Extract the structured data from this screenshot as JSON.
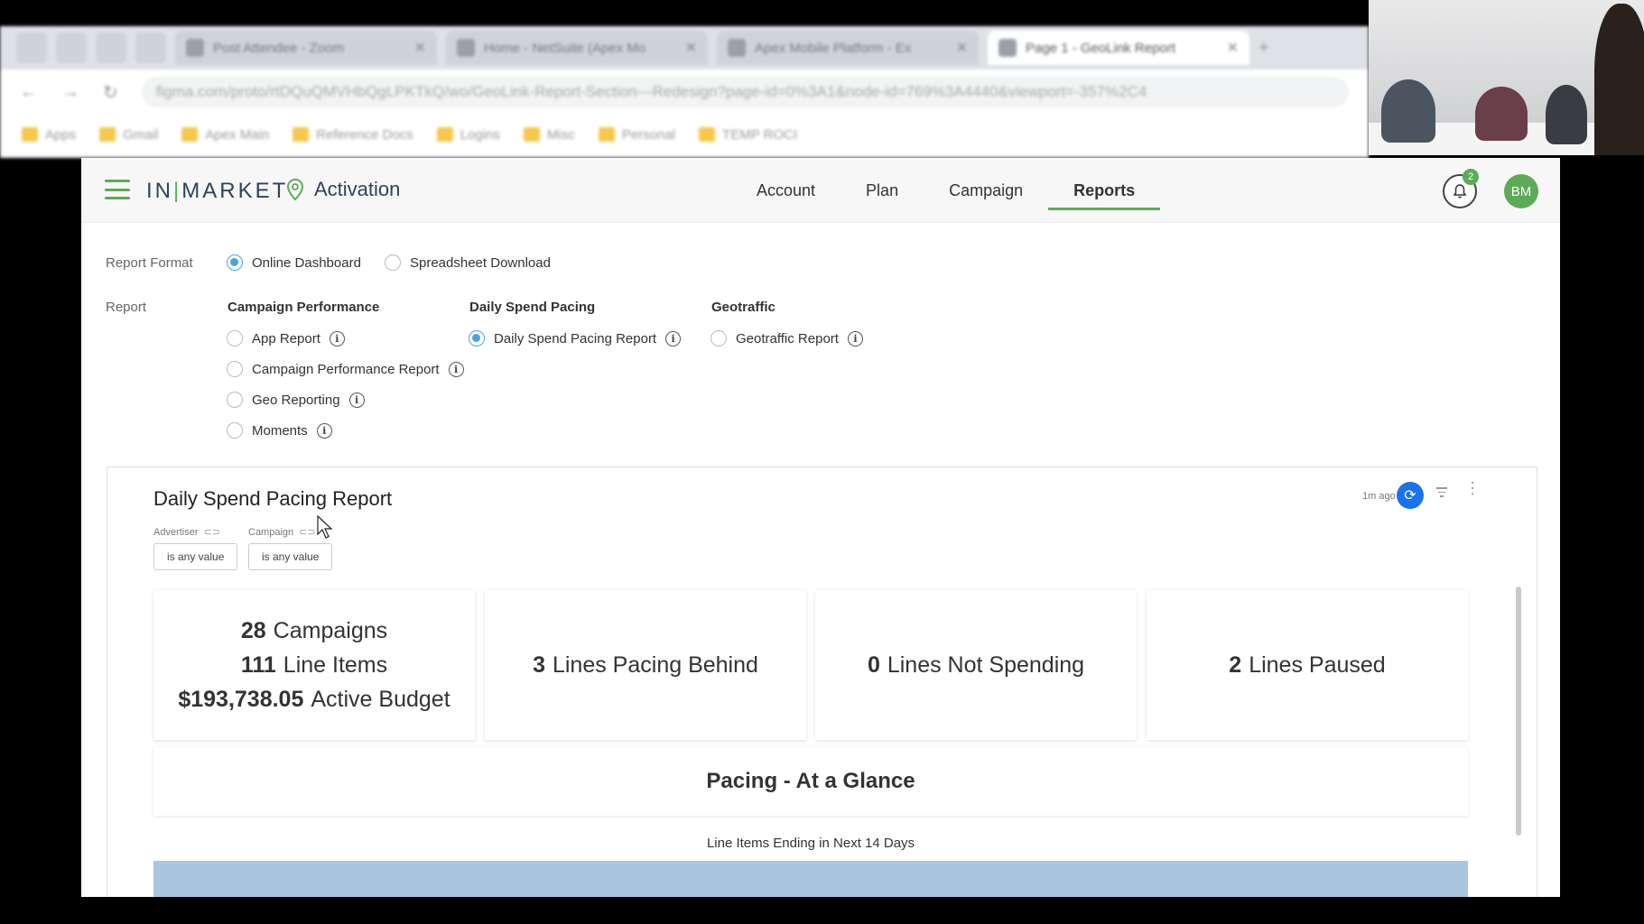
{
  "browser": {
    "tabs": [
      {
        "title": "Post Attendee - Zoom"
      },
      {
        "title": "Home - NetSuite (Apex Mo"
      },
      {
        "title": "Apex Mobile Platform - Ex"
      },
      {
        "title": "Page 1 - GeoLink Report"
      }
    ],
    "url": "figma.com/proto/rtDQuQMVHbQgLPKTkQ/wo/GeoLink-Report-Section---Redesign?page-id=0%3A1&node-id=769%3A4440&viewport=-357%2C4",
    "bookmarks": [
      "Apps",
      "Gmail",
      "Apex Main",
      "Reference Docs",
      "Logins",
      "Misc",
      "Personal",
      "TEMP ROCI"
    ]
  },
  "app": {
    "brand": "IN|MARKET",
    "brand_left": "IN",
    "brand_right": "MARKET",
    "product": "Activation",
    "nav": [
      "Account",
      "Plan",
      "Campaign",
      "Reports"
    ],
    "active_nav": "Reports",
    "notifications": "2",
    "user_initials": "BM",
    "accent_color": "#5cab57"
  },
  "form": {
    "report_format_label": "Report Format",
    "format_options": [
      "Online Dashboard",
      "Spreadsheet Download"
    ],
    "selected_format": "Online Dashboard",
    "report_label": "Report",
    "groups": [
      {
        "title": "Campaign Performance",
        "options": [
          "App Report",
          "Campaign Performance Report",
          "Geo Reporting",
          "Moments"
        ]
      },
      {
        "title": "Daily Spend Pacing",
        "options": [
          "Daily Spend Pacing Report"
        ]
      },
      {
        "title": "Geotraffic",
        "options": [
          "Geotraffic Report"
        ]
      }
    ],
    "selected_report": "Daily Spend Pacing Report",
    "info_glyph": "i"
  },
  "dashboard": {
    "title": "Daily Spend Pacing Report",
    "filters": [
      {
        "label": "Advertiser",
        "value": "is any value"
      },
      {
        "label": "Campaign",
        "value": "is any value"
      }
    ],
    "updated": "1m ago",
    "refresh_glyph": "⟳",
    "menu_glyph": "⋮",
    "link_glyph": "⊂⊃",
    "cards": [
      {
        "stats": [
          {
            "num": "28",
            "label": "Campaigns"
          },
          {
            "num": "111",
            "label": "Line Items"
          },
          {
            "num": "$193,738.05",
            "label": "Active Budget"
          }
        ]
      },
      {
        "stats": [
          {
            "num": "3",
            "label": "Lines Pacing Behind"
          }
        ]
      },
      {
        "stats": [
          {
            "num": "0",
            "label": "Lines Not Spending"
          }
        ]
      },
      {
        "stats": [
          {
            "num": "2",
            "label": "Lines Paused"
          }
        ]
      }
    ],
    "section_title": "Pacing - At a Glance",
    "table_title": "Line Items Ending in Next 14 Days",
    "header_color": "#aac6df"
  }
}
